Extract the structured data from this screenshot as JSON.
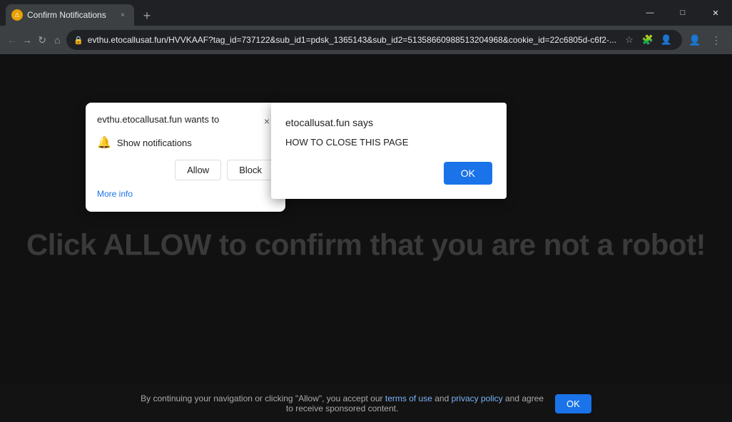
{
  "window": {
    "title": "Confirm Notifications",
    "tab_close_symbol": "×",
    "new_tab_symbol": "+",
    "minimize": "—",
    "maximize": "□",
    "close": "✕"
  },
  "address_bar": {
    "url": "evthu.etocallusat.fun/HVVKAAF?tag_id=737122&sub_id1=pdsk_1365143&sub_id2=51358660988513204968&cookie_id=22c6805d-c6f2-..."
  },
  "notification_dialog": {
    "title": "evthu.etocallusat.fun wants to",
    "close_symbol": "×",
    "bell_symbol": "🔔",
    "show_label": "Show notifications",
    "allow_label": "Allow",
    "block_label": "Block",
    "more_info_label": "More info"
  },
  "site_dialog": {
    "title": "etocallusat.fun says",
    "message": "HOW TO CLOSE THIS PAGE",
    "ok_label": "OK"
  },
  "page": {
    "main_text": "Click ALLOW to confirm that you are not a robot!",
    "footer_text": "By continuing your navigation or clicking \"Allow\", you accept our",
    "footer_terms": "terms of use",
    "footer_and": "and",
    "footer_privacy": "privacy policy",
    "footer_suffix": "and agree\nto receive sponsored content.",
    "footer_ok_label": "OK"
  }
}
